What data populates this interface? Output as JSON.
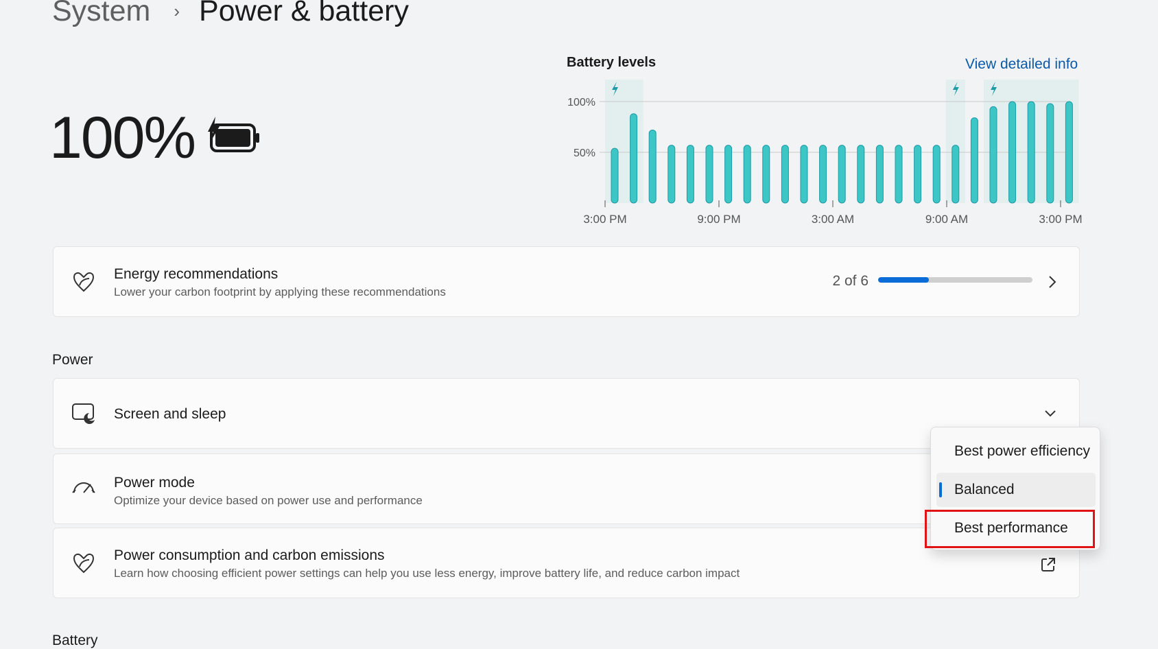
{
  "breadcrumb": {
    "parent": "System",
    "separator": "›",
    "current": "Power & battery"
  },
  "battery": {
    "percent_label": "100%",
    "icon": "battery-charging-icon"
  },
  "chart_data": {
    "type": "bar",
    "title": "Battery levels",
    "link": "View detailed info",
    "y_ticks": [
      "100%",
      "50%"
    ],
    "x_ticks": [
      "3:00 PM",
      "9:00 PM",
      "3:00 AM",
      "9:00 AM",
      "3:00 PM"
    ],
    "ylim": [
      0,
      100
    ],
    "values": [
      54,
      88,
      72,
      57,
      57,
      57,
      57,
      57,
      57,
      57,
      57,
      57,
      57,
      57,
      57,
      57,
      57,
      57,
      57,
      84,
      95,
      100,
      100,
      98,
      100
    ],
    "charging_bars": [
      0,
      1,
      18,
      20,
      21,
      22,
      23,
      24
    ],
    "charging_markers": [
      0,
      18,
      20
    ],
    "bar_color": "#3cc6c6",
    "shade_color": "#e3eeee"
  },
  "energy": {
    "title": "Energy recommendations",
    "desc": "Lower your carbon footprint by applying these recommendations",
    "count": "2 of 6",
    "progress": 0.33
  },
  "power_section": {
    "label": "Power"
  },
  "screen_sleep": {
    "title": "Screen and sleep"
  },
  "power_mode": {
    "title": "Power mode",
    "desc": "Optimize your device based on power use and performance",
    "options": [
      "Best power efficiency",
      "Balanced",
      "Best performance"
    ],
    "selected": "Balanced"
  },
  "consumption": {
    "title": "Power consumption and carbon emissions",
    "desc": "Learn how choosing efficient power settings can help you use less energy, improve battery life, and reduce carbon impact"
  },
  "battery_section": {
    "label": "Battery"
  }
}
